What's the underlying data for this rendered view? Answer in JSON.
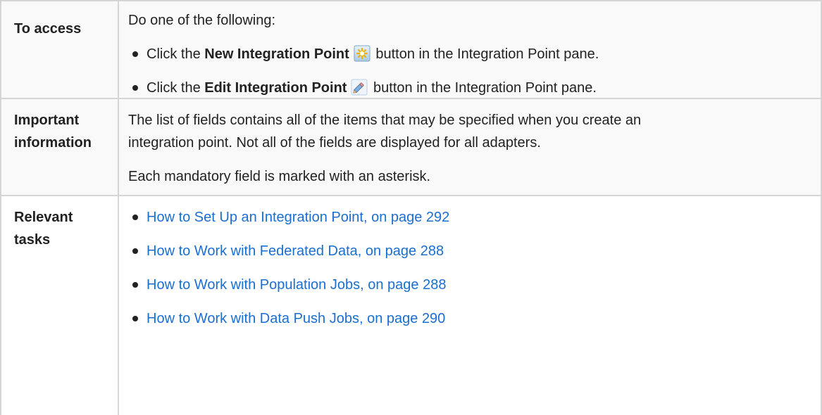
{
  "rows": {
    "access": {
      "label": "To access",
      "intro": "Do one of the following:",
      "items": [
        {
          "prefix": "Click the ",
          "bold": "New Integration Point",
          "icon": "new-integration-point-icon",
          "suffix": " button in the Integration Point pane."
        },
        {
          "prefix": "Click the ",
          "bold": "Edit Integration Point",
          "icon": "edit-pencil-icon",
          "suffix": " button in the Integration Point pane."
        }
      ]
    },
    "info": {
      "label_line1": "Important",
      "label_line2": "information",
      "para1_line1": "The list of fields contains all of the items that may be specified when you create an",
      "para1_line2": "integration point. Not all of the fields are displayed for all adapters.",
      "para2": "Each mandatory field is marked with an asterisk."
    },
    "tasks": {
      "label_line1": "Relevant",
      "label_line2": "tasks",
      "links": [
        "How to Set Up an Integration Point, on page 292",
        "How to Work with Federated Data, on page 288",
        "How to Work with Population Jobs, on page 288",
        "How to Work with Data Push Jobs, on page 290"
      ]
    }
  },
  "colors": {
    "link": "#1a6fd1",
    "border": "#d5d5d5",
    "row_shade": "#f9f9f9",
    "text": "#222222"
  }
}
